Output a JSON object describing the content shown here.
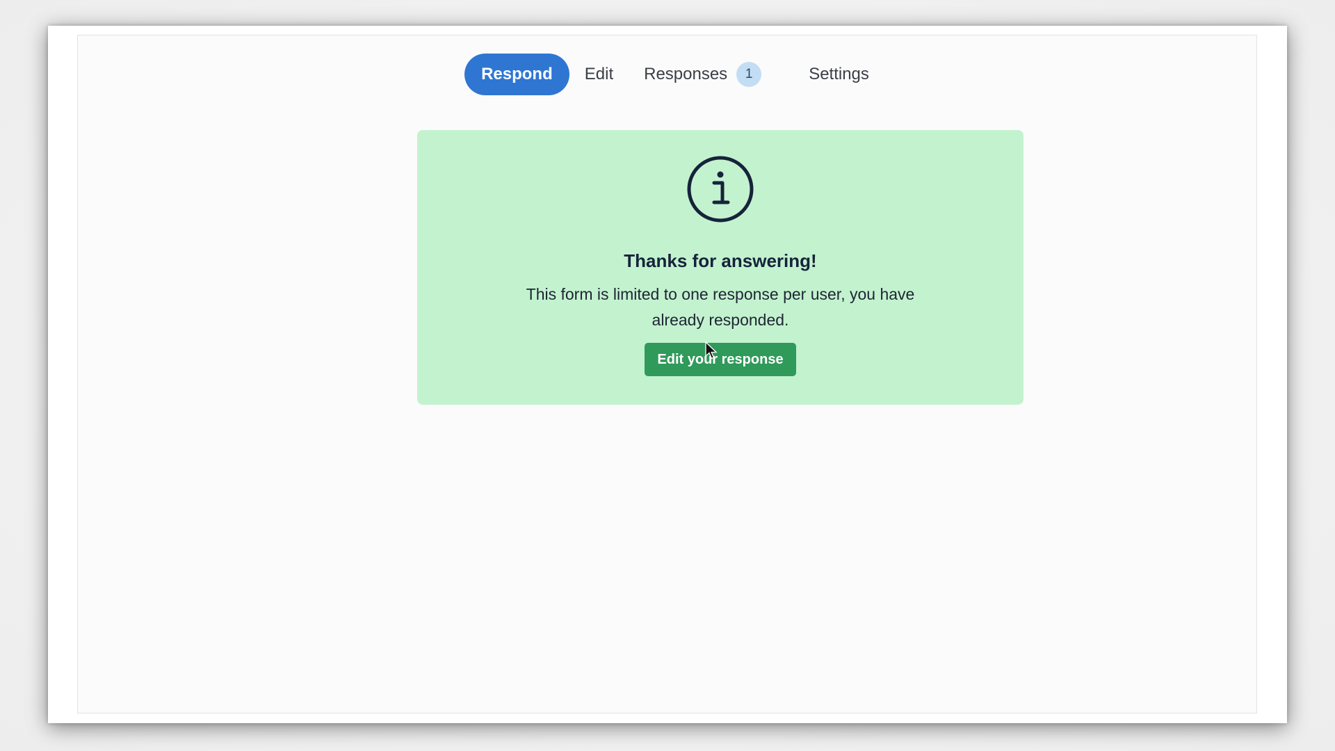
{
  "tabs": [
    {
      "label": "Respond",
      "active": true
    },
    {
      "label": "Edit",
      "active": false
    },
    {
      "label": "Responses",
      "active": false,
      "badge": "1"
    },
    {
      "label": "Settings",
      "active": false
    }
  ],
  "notice": {
    "icon": "info-icon",
    "title": "Thanks for answering!",
    "message": "This form is limited to one response per user, you have already responded.",
    "button_label": "Edit your response"
  },
  "colors": {
    "active_tab": "#2f76d2",
    "badge_bg": "#c3ddf5",
    "notice_bg": "#c3f2cf",
    "button_bg": "#2f9a5a"
  }
}
